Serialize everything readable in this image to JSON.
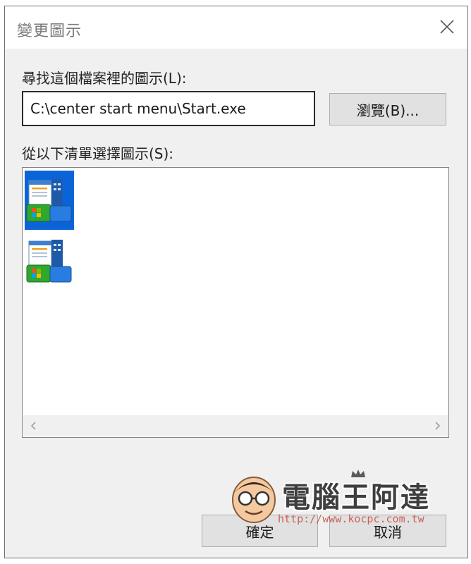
{
  "dialog": {
    "title": "變更圖示",
    "file_label": "尋找這個檔案裡的圖示(L):",
    "file_path": "C:\\center start menu\\Start.exe",
    "browse_label": "瀏覽(B)...",
    "list_label": "從以下清單選擇圖示(S):",
    "icons": [
      {
        "name": "start-menu-icon",
        "selected": true
      },
      {
        "name": "start-menu-icon",
        "selected": false
      }
    ],
    "ok_label": "確定",
    "cancel_label": "取消",
    "accent_color": "#0a64d8"
  },
  "watermark": {
    "site_name": "電腦王阿達",
    "url": "http://www.kocpc.com.tw"
  }
}
